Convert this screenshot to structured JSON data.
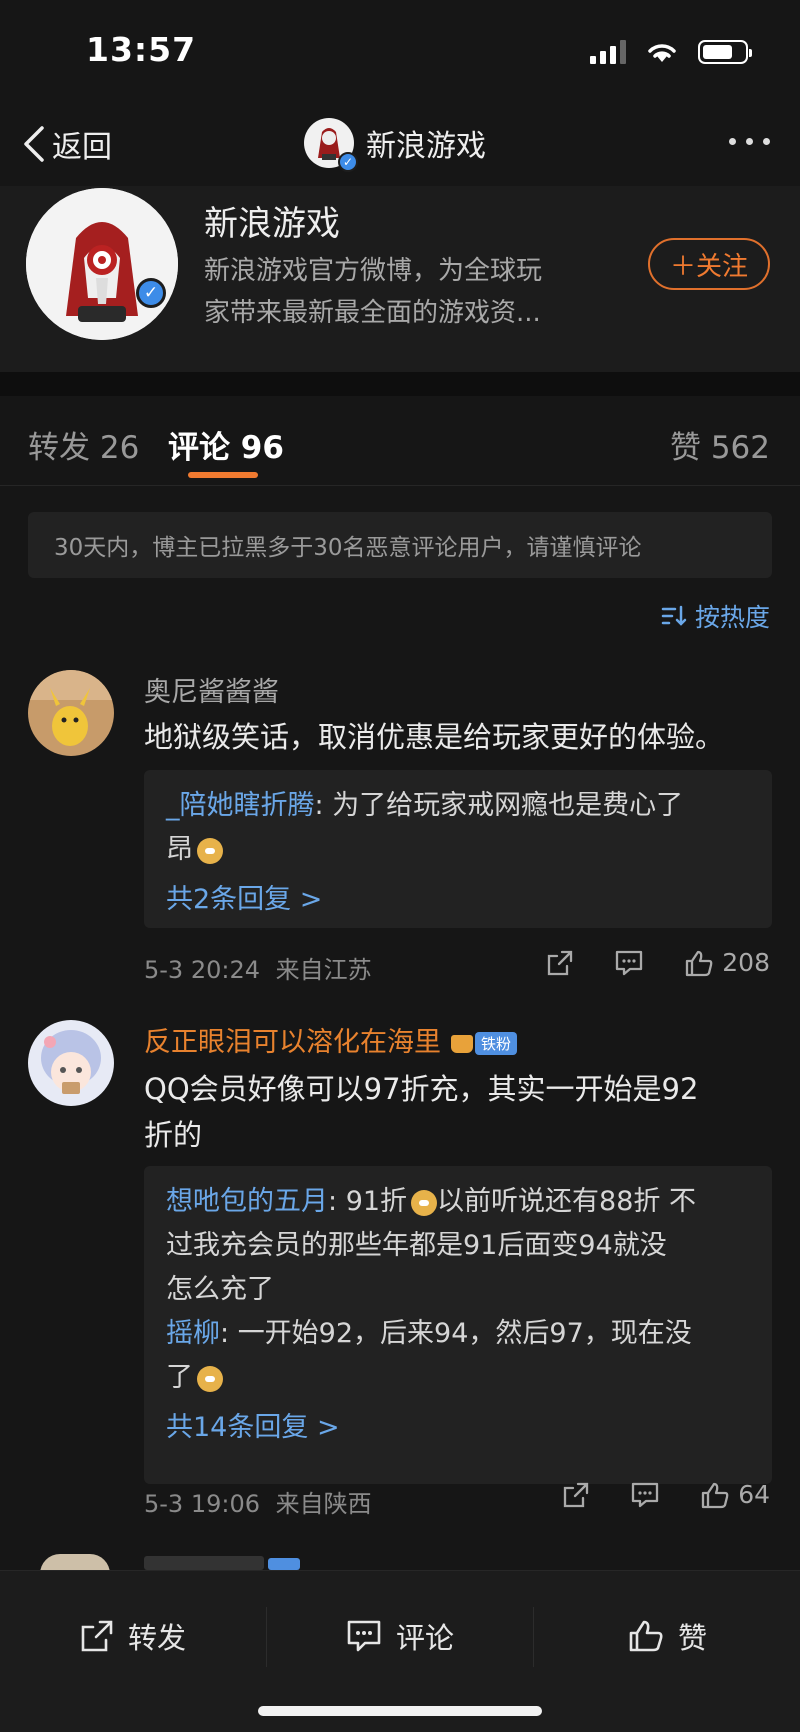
{
  "status_bar": {
    "time": "13:57",
    "battery_level": 0.72
  },
  "nav": {
    "back_label": "返回",
    "title": "新浪游戏",
    "more_icon": "more-dots-icon"
  },
  "profile": {
    "name": "新浪游戏",
    "desc_line1": "新浪游戏官方微博，为全球玩",
    "desc_line2": "家带来最新最全面的游戏资...",
    "follow_label": "＋关注"
  },
  "tabs": {
    "repost": "转发 26",
    "comments": "评论 96",
    "likes": "赞 562"
  },
  "notice": "30天内，博主已拉黑多于30名恶意评论用户，请谨慎评论",
  "sort_label": "按热度",
  "comments": [
    {
      "user": "奥尼酱酱酱",
      "text": "地狱级笑话，取消优惠是给玩家更好的体验。",
      "replies": [
        {
          "user": "_陪她瞎折腾",
          "text_line1": "为了给玩家戒网瘾也是费心了",
          "text_line2": "昂"
        }
      ],
      "more_replies": "共2条回复 >",
      "time": "5-3 20:24",
      "location": "来自江苏",
      "likes": "208"
    },
    {
      "user": "反正眼泪可以溶化在海里",
      "badge": "铁粉",
      "text_line1": "QQ会员好像可以97折充，其实一开始是92",
      "text_line2": "折的",
      "replies": [
        {
          "user": "想吔包的五月",
          "seg1": "91折",
          "seg2": "以前听说还有88折 不",
          "line2": "过我充会员的那些年都是91后面变94就没",
          "line3": "怎么充了"
        },
        {
          "user": "摇柳",
          "line1": "一开始92，后来94，然后97，现在没",
          "line2": "了"
        }
      ],
      "more_replies": "共14条回复 >",
      "time": "5-3 19:06",
      "location": "来自陕西",
      "likes": "64"
    }
  ],
  "bottom_bar": {
    "repost": "转发",
    "comment": "评论",
    "like": "赞"
  },
  "colors": {
    "accent": "#f07a30",
    "link": "#6aa7e8",
    "background": "#161616"
  }
}
